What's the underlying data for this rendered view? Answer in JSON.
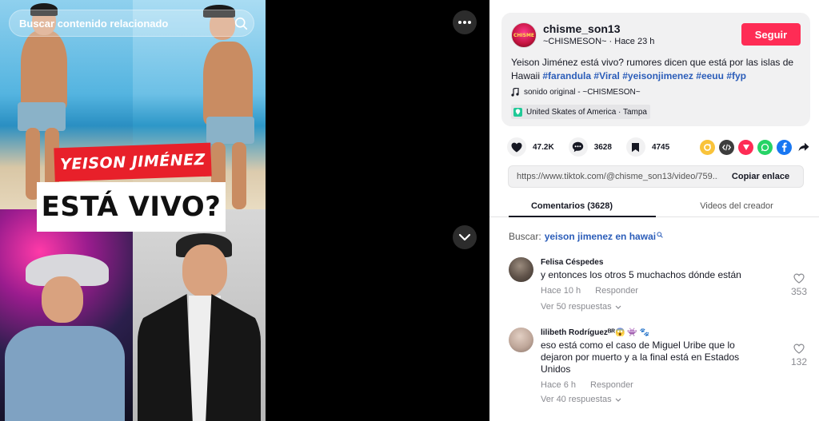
{
  "search": {
    "placeholder": "Buscar contenido relacionado"
  },
  "video": {
    "title_line1": "YEISON JIMÉNEZ",
    "title_line2": "ESTÁ VIVO?"
  },
  "author": {
    "username": "chisme_son13",
    "nickname": "~CHISMESON~",
    "separator": " · ",
    "time": "Hace 23 h",
    "avatar_text": "CHISME",
    "follow_label": "Seguir"
  },
  "caption": {
    "text": "Yeison Jiménez está vivo? rumores dicen que está por las islas de Hawaii ",
    "hashtags": [
      "#farandula",
      "#Viral",
      "#yeisonjimenez",
      "#eeuu",
      "#fyp"
    ]
  },
  "music": {
    "label": "sonido original - ~CHISMESON~"
  },
  "location": {
    "label": "United Skates of America · Tampa"
  },
  "stats": {
    "likes": "47.2K",
    "comments": "3628",
    "saves": "4745"
  },
  "share": {
    "icons": [
      "share-circle-icon",
      "embed-icon",
      "tiktok-repost-icon",
      "whatsapp-icon",
      "facebook-icon",
      "share-arrow-icon"
    ],
    "colors": {
      "circle": "#f9c33a",
      "embed": "#3d3d3d",
      "repost": "#fe2c55",
      "whatsapp": "#25d366",
      "facebook": "#1877f2"
    }
  },
  "copy_link": {
    "url": "https://www.tiktok.com/@chisme_son13/video/759...",
    "button_label": "Copiar enlace"
  },
  "tabs": [
    {
      "label": "Comentarios (3628)",
      "active": true
    },
    {
      "label": "Videos del creador",
      "active": false
    }
  ],
  "search_related": {
    "label": "Buscar:",
    "query": "yeison jimenez en hawai"
  },
  "comments": [
    {
      "name": "Felisa Céspedes",
      "text": "y entonces los otros 5 muchachos dónde están",
      "time": "Hace 10 h",
      "reply_label": "Responder",
      "more_replies": "Ver 50 respuestas",
      "likes": "353"
    },
    {
      "name": "lilibeth Rodríguezᴮᴿ😱 👾 🐾",
      "text": "eso está como el caso de Miguel Uribe que lo dejaron por muerto y a la final está en Estados Unidos",
      "time": "Hace 6 h",
      "reply_label": "Responder",
      "more_replies": "Ver 40 respuestas",
      "likes": "132"
    }
  ],
  "colors": {
    "accent": "#fe2c55",
    "hashtag": "#2b5db9",
    "title_red": "#e8202a"
  }
}
